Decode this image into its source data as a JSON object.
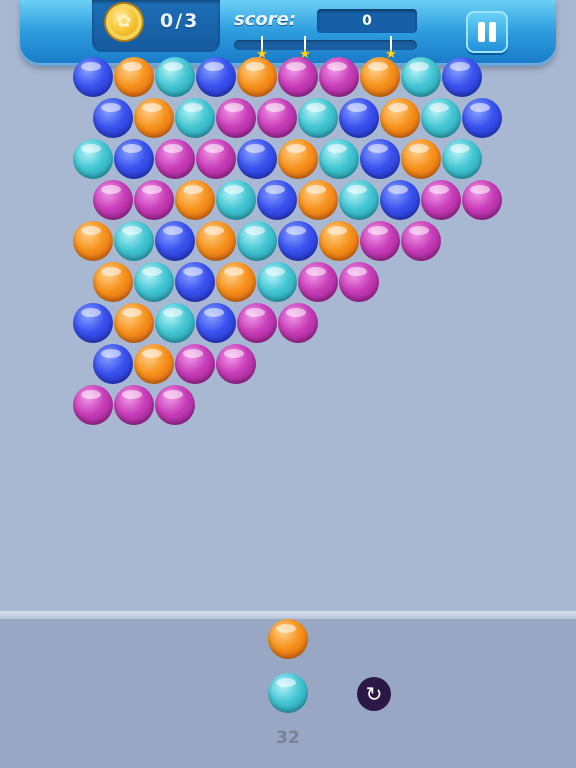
{
  "hud": {
    "coins": "0/3",
    "score_label": "score:",
    "score_value": "0",
    "score_progress": 0,
    "star_markers": 3
  },
  "icons": {
    "coin": "coin-icon",
    "star": "star-icon",
    "pause": "pause-icon",
    "swap": "refresh-icon"
  },
  "colors": {
    "blue": "#3a52ee",
    "orange": "#f6921c",
    "teal": "#43c6d3",
    "purple": "#c83db8",
    "background": "#a9b8d2"
  },
  "bubble_grid": [
    [
      "b",
      "o",
      "t",
      "b",
      "o",
      "p",
      "p",
      "o",
      "t",
      "b"
    ],
    [
      "b",
      "o",
      "t",
      "p",
      "p",
      "t",
      "b",
      "o",
      "t",
      "b"
    ],
    [
      "t",
      "b",
      "p",
      "p",
      "b",
      "o",
      "t",
      "b",
      "o",
      "t"
    ],
    [
      "p",
      "p",
      "o",
      "t",
      "b",
      "o",
      "t",
      "b",
      "p",
      "p"
    ],
    [
      "o",
      "t",
      "b",
      "o",
      "t",
      "b",
      "o",
      "p",
      "p"
    ],
    [
      "o",
      "t",
      "b",
      "o",
      "t",
      "p",
      "p"
    ],
    [
      "b",
      "o",
      "t",
      "b",
      "p",
      "p"
    ],
    [
      "b",
      "o",
      "p",
      "p"
    ],
    [
      "p",
      "p",
      "p"
    ]
  ],
  "shooter": {
    "current": "o",
    "next": "t",
    "shots_left": "32"
  }
}
